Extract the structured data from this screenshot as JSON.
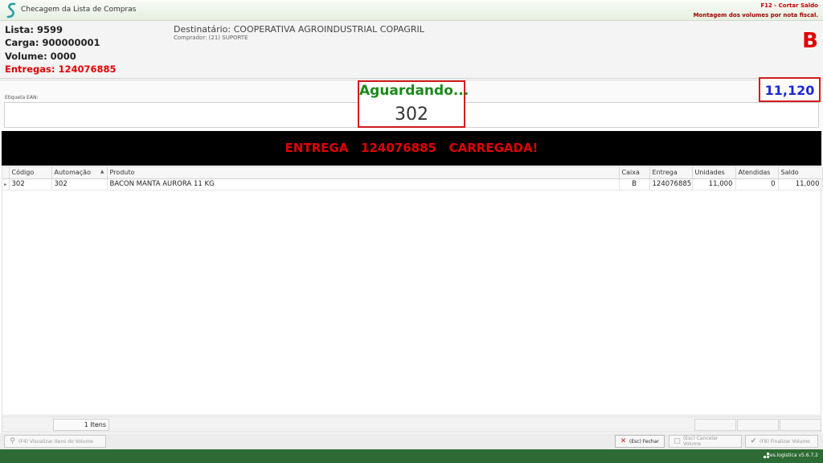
{
  "window": {
    "title": "Checagem da Lista de Compras",
    "hint_f12": "F12 - Cortar Saldo",
    "hint_mode": "Montagem dos volumes por nota fiscal."
  },
  "header": {
    "lista": "Lista: 9599",
    "carga": "Carga: 900000001",
    "volume": "Volume: 0000",
    "entregas": "Entregas: 124076885",
    "destinatario": "Destinatário: COOPERATIVA AGROINDUSTRIAL COPAGRIL",
    "comprador": "Comprador: (21) SUPORTE",
    "caixa": "B"
  },
  "scan": {
    "ean_label": "Etiqueta EAN:",
    "status": "Aguardando...",
    "last_code": "302",
    "quantity": "11,120"
  },
  "banner": {
    "message": "ENTREGA   124076885   CARREGADA!"
  },
  "grid": {
    "columns": [
      "Código",
      "Automação",
      "Produto",
      "Caixa",
      "Entrega",
      "Unidades",
      "Atendidas",
      "Saldo"
    ],
    "rows": [
      {
        "codigo": "302",
        "automacao": "302",
        "produto": "BACON MANTA AURORA 11 KG",
        "caixa": "B",
        "entrega": "124076885",
        "unidades": "11,000",
        "atendidas": "0",
        "saldo": "11,000"
      }
    ],
    "item_count": "1 Itens"
  },
  "actions": {
    "view_items": "(F4) Visualizar Itens do Volume",
    "close": "(Esc) Fechar",
    "cancel_volume": "(Esc) Cancelar Volume",
    "finish_volume": "(F8) Finalizar Volume"
  },
  "status_bar": {
    "version": "ces.logistica v5.6.7.2"
  },
  "colors": {
    "accent_green": "#1a8a1a",
    "alert_red": "#e00000",
    "quantity_blue": "#1d27d6",
    "statusbar_green": "#2e6b34"
  }
}
